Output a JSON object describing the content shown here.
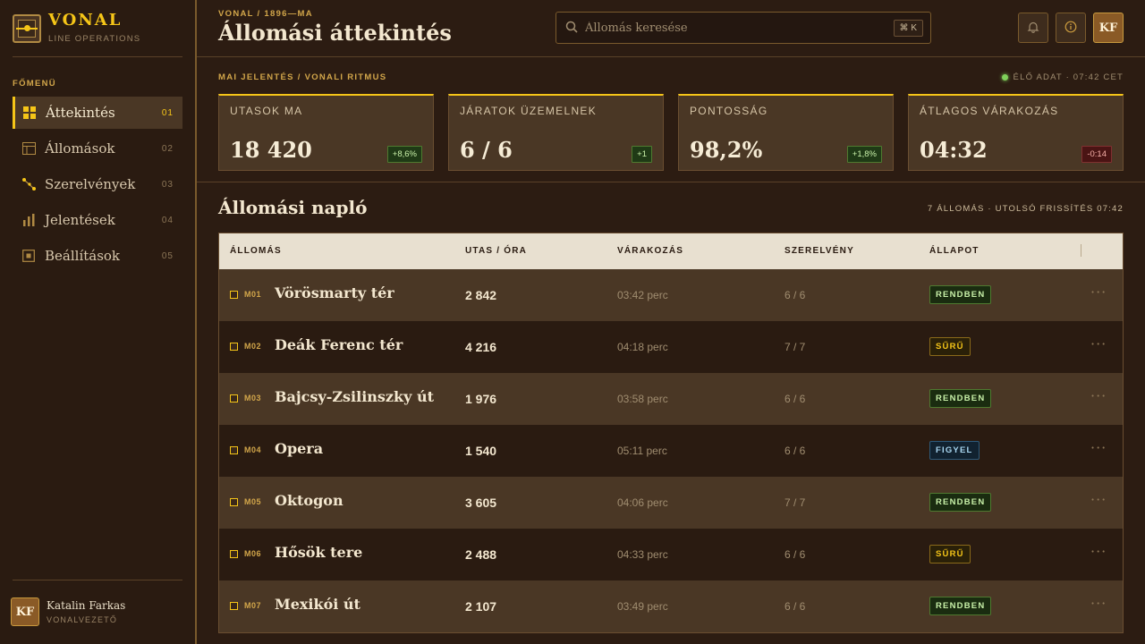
{
  "brand": {
    "name": "VONAL",
    "subtitle": "LINE OPERATIONS"
  },
  "sidebar": {
    "menu_label": "FŐMENÜ",
    "items": [
      {
        "label": "Áttekintés",
        "num": "01",
        "icon": "grid-icon",
        "active": true
      },
      {
        "label": "Állomások",
        "num": "02",
        "icon": "table-icon",
        "active": false
      },
      {
        "label": "Szerelvények",
        "num": "03",
        "icon": "route-icon",
        "active": false
      },
      {
        "label": "Jelentések",
        "num": "04",
        "icon": "bar-chart-icon",
        "active": false
      },
      {
        "label": "Beállítások",
        "num": "05",
        "icon": "settings-icon",
        "active": false
      }
    ]
  },
  "user": {
    "initials": "KF",
    "name": "Katalin Farkas",
    "role": "VONALVEZETŐ"
  },
  "header": {
    "crumb": "VONAL / 1896—MA",
    "title": "Állomási áttekintés",
    "search_placeholder": "Állomás keresése",
    "shortcut": "⌘ K",
    "avatar_initials": "KF"
  },
  "report": {
    "label": "MAI JELENTÉS / VONALI RITMUS",
    "live": "ÉLŐ ADAT · 07:42 CET",
    "cards": [
      {
        "label": "UTASOK MA",
        "value": "18 420",
        "delta": "+8,6%",
        "trend": "pos"
      },
      {
        "label": "JÁRATOK ÜZEMELNEK",
        "value": "6 / 6",
        "delta": "+1",
        "trend": "pos"
      },
      {
        "label": "PONTOSSÁG",
        "value": "98,2%",
        "delta": "+1,8%",
        "trend": "pos"
      },
      {
        "label": "ÁTLAGOS VÁRAKOZÁS",
        "value": "04:32",
        "delta": "-0:14",
        "trend": "neg"
      }
    ]
  },
  "log": {
    "title": "Állomási napló",
    "meta": "7 ÁLLOMÁS · UTOLSÓ FRISSÍTÉS 07:42",
    "columns": [
      "ÁLLOMÁS",
      "UTAS / ÓRA",
      "VÁRAKOZÁS",
      "SZERELVÉNY",
      "ÁLLAPOT"
    ],
    "rows": [
      {
        "code": "M01",
        "name": "Vörösmarty tér",
        "pax": "2 842",
        "wait": "03:42 perc",
        "trains": "6 / 6",
        "status": "RENDBEN",
        "kind": "ok"
      },
      {
        "code": "M02",
        "name": "Deák Ferenc tér",
        "pax": "4 216",
        "wait": "04:18 perc",
        "trains": "7 / 7",
        "status": "SŰRŰ",
        "kind": "busy"
      },
      {
        "code": "M03",
        "name": "Bajcsy-Zsilinszky út",
        "pax": "1 976",
        "wait": "03:58 perc",
        "trains": "6 / 6",
        "status": "RENDBEN",
        "kind": "ok"
      },
      {
        "code": "M04",
        "name": "Opera",
        "pax": "1 540",
        "wait": "05:11 perc",
        "trains": "6 / 6",
        "status": "FIGYEL",
        "kind": "watch"
      },
      {
        "code": "M05",
        "name": "Oktogon",
        "pax": "3 605",
        "wait": "04:06 perc",
        "trains": "7 / 7",
        "status": "RENDBEN",
        "kind": "ok"
      },
      {
        "code": "M06",
        "name": "Hősök tere",
        "pax": "2 488",
        "wait": "04:33 perc",
        "trains": "6 / 6",
        "status": "SŰRŰ",
        "kind": "busy"
      },
      {
        "code": "M07",
        "name": "Mexikói út",
        "pax": "2 107",
        "wait": "03:49 perc",
        "trains": "6 / 6",
        "status": "RENDBEN",
        "kind": "ok"
      }
    ]
  },
  "colors": {
    "accent": "#f5c518",
    "bg": "#2c1c12",
    "card": "#4a3725"
  }
}
